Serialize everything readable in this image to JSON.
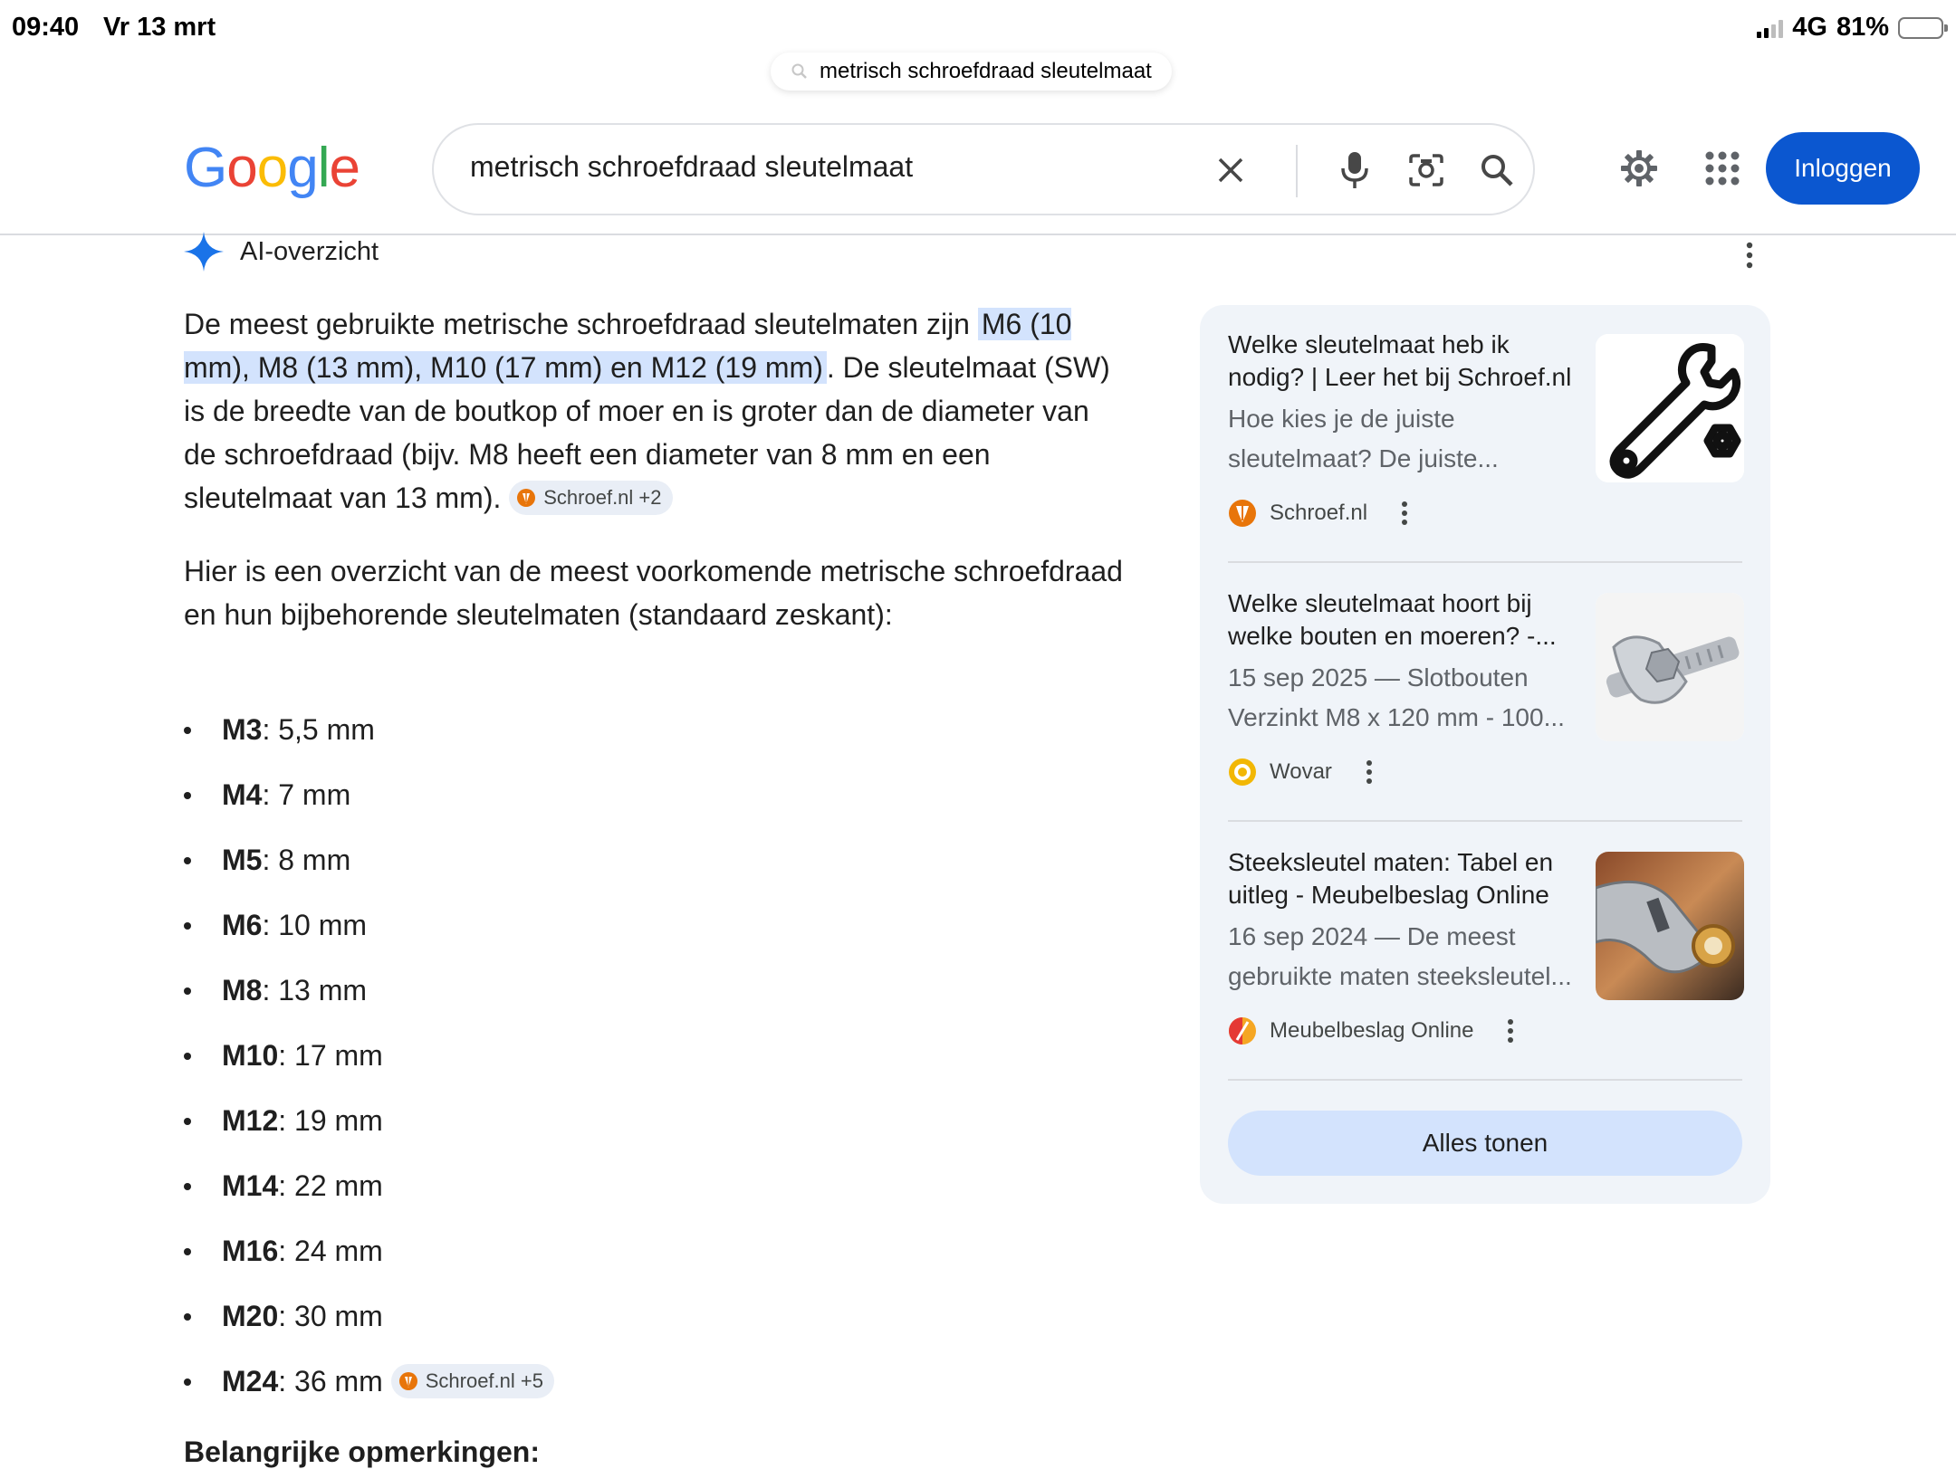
{
  "status_bar": {
    "time": "09:40",
    "date": "Vr 13 mrt",
    "network": "4G",
    "battery": "81%"
  },
  "browser": {
    "url_text": "metrisch schroefdraad sleutelmaat"
  },
  "header": {
    "logo": "Google",
    "query": "metrisch schroefdraad sleutelmaat",
    "login_label": "Inloggen"
  },
  "ai_overview": {
    "title": "AI-overzicht",
    "intro_before": "De meest gebruikte metrische schroefdraad sleutelmaten zijn ",
    "intro_highlight": "M6 (10 mm), M8 (13 mm), M10 (17 mm) en M12 (19 mm)",
    "intro_after": ". De sleutelmaat (SW) is de breedte van de boutkop of moer en is groter dan de diameter van de schroefdraad (bijv. M8 heeft een diameter van 8 mm en een sleutelmaat van 13 mm). ",
    "intro_chip": "Schroef.nl +2",
    "para2": "Hier is een overzicht van de meest voorkomende metrische schroefdraad en hun bijbehorende sleutelmaten (standaard zeskant):",
    "specs": [
      {
        "size": "M3",
        "value": ": 5,5 mm"
      },
      {
        "size": "M4",
        "value": ": 7 mm"
      },
      {
        "size": "M5",
        "value": ": 8 mm"
      },
      {
        "size": "M6",
        "value": ": 10 mm"
      },
      {
        "size": "M8",
        "value": ": 13 mm"
      },
      {
        "size": "M10",
        "value": ": 17 mm"
      },
      {
        "size": "M12",
        "value": ": 19 mm"
      },
      {
        "size": "M14",
        "value": ": 22 mm"
      },
      {
        "size": "M16",
        "value": ": 24 mm"
      },
      {
        "size": "M20",
        "value": ": 30 mm"
      },
      {
        "size": "M24",
        "value": ": 36 mm"
      }
    ],
    "last_chip": "Schroef.nl +5",
    "notes_heading": "Belangrijke opmerkingen:"
  },
  "sources": {
    "items": [
      {
        "title": "Welke sleutelmaat heb ik nodig? | Leer het bij Schroef.nl",
        "snippet": "Hoe kies je de juiste sleutelmaat? De juiste...",
        "site": "Schroef.nl"
      },
      {
        "title": "Welke sleutelmaat hoort bij welke bouten en moeren? -...",
        "snippet": "15 sep 2025 — Slotbouten Verzinkt M8 x 120 mm - 100...",
        "site": "Wovar"
      },
      {
        "title": "Steeksleutel maten: Tabel en uitleg - Meubelbeslag Online",
        "snippet": "16 sep 2024 — De meest gebruikte maten steeksleutel...",
        "site": "Meubelbeslag Online"
      }
    ],
    "show_all_label": "Alles tonen"
  },
  "colors": {
    "accent": "#0b57d0",
    "highlight": "#d3e3fd",
    "panel": "#f0f4f9"
  }
}
